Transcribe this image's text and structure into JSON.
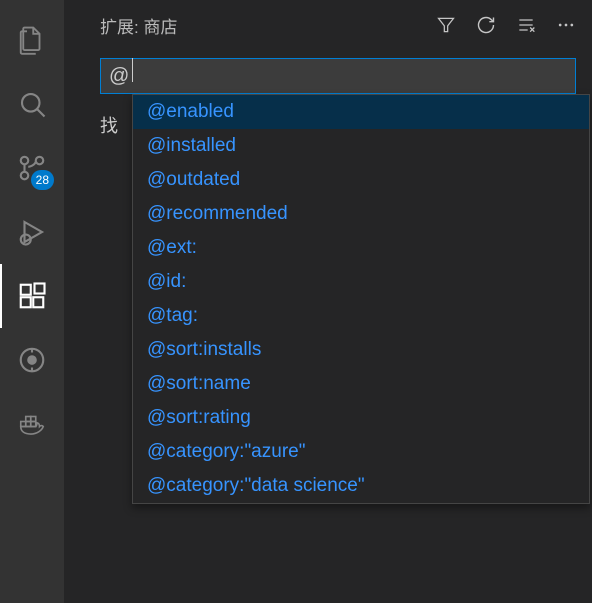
{
  "activityBar": {
    "items": [
      {
        "name": "explorer",
        "icon": "files"
      },
      {
        "name": "search",
        "icon": "search"
      },
      {
        "name": "source-control",
        "icon": "scm",
        "badge": "28"
      },
      {
        "name": "run-debug",
        "icon": "debug"
      },
      {
        "name": "extensions",
        "icon": "extensions",
        "active": true
      },
      {
        "name": "remote",
        "icon": "remote"
      },
      {
        "name": "docker",
        "icon": "docker"
      }
    ]
  },
  "header": {
    "title": "扩展: 商店"
  },
  "search": {
    "value": "@"
  },
  "hint": {
    "text": "找"
  },
  "suggestions": [
    {
      "label": "@enabled",
      "selected": true
    },
    {
      "label": "@installed"
    },
    {
      "label": "@outdated"
    },
    {
      "label": "@recommended"
    },
    {
      "label": "@ext:"
    },
    {
      "label": "@id:"
    },
    {
      "label": "@tag:"
    },
    {
      "label": "@sort:installs"
    },
    {
      "label": "@sort:name"
    },
    {
      "label": "@sort:rating"
    },
    {
      "label": "@category:\"azure\""
    },
    {
      "label": "@category:\"data science\""
    }
  ]
}
